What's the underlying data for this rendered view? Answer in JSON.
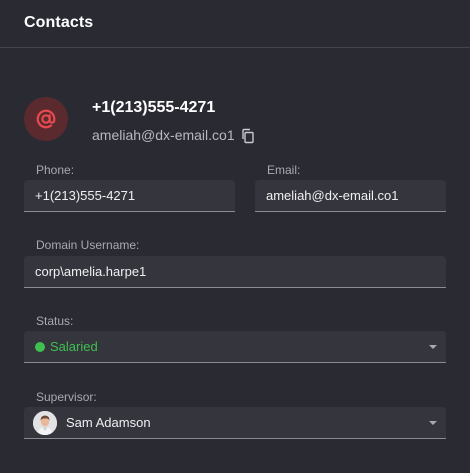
{
  "header": {
    "title": "Contacts"
  },
  "contact": {
    "primary_phone": "+1(213)555-4271",
    "primary_email": "ameliah@dx-email.co1"
  },
  "fields": {
    "phone": {
      "label": "Phone:",
      "value": "+1(213)555-4271"
    },
    "email": {
      "label": "Email:",
      "value": "ameliah@dx-email.co1"
    },
    "domain_username": {
      "label": "Domain Username:",
      "value": "corp\\amelia.harpe1"
    },
    "status": {
      "label": "Status:",
      "value": "Salaried",
      "color": "#3fbf4f"
    },
    "supervisor": {
      "label": "Supervisor:",
      "value": "Sam Adamson"
    }
  },
  "icons": {
    "avatar": "at-icon",
    "copy": "copy-icon",
    "dropdown": "chevron-down-icon"
  },
  "colors": {
    "background": "#2a2a33",
    "field_background": "#35353e",
    "accent_red": "#e84a4f",
    "status_green": "#3fbf4f"
  }
}
